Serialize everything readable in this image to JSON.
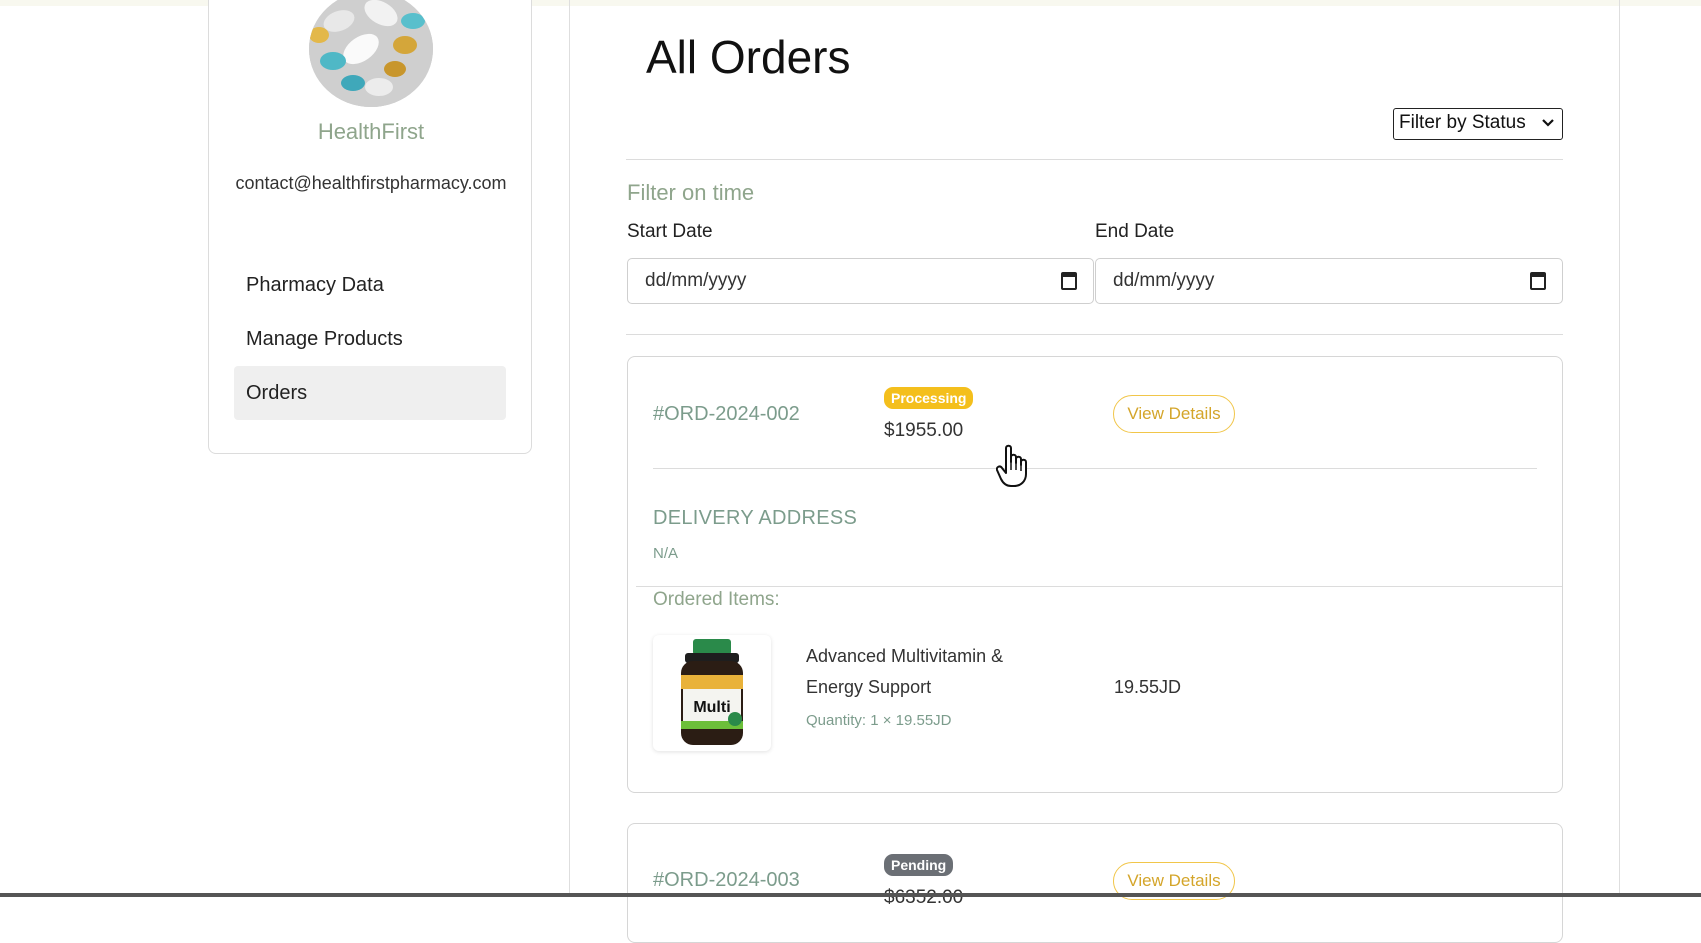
{
  "sidebar": {
    "pharmacy_name": "HealthFirst",
    "email": "contact@healthfirstpharmacy.com",
    "avatar_icon": "pills-photo",
    "nav": [
      {
        "label": "Pharmacy Data",
        "active": false
      },
      {
        "label": "Manage Products",
        "active": false
      },
      {
        "label": "Orders",
        "active": true
      }
    ]
  },
  "main": {
    "title": "All Orders",
    "status_filter": {
      "selected": "Filter by Status"
    },
    "time_filter": {
      "title": "Filter on time",
      "start_label": "Start Date",
      "end_label": "End Date",
      "start_placeholder": "dd/mm/yyyy",
      "end_placeholder": "dd/mm/yyyy"
    }
  },
  "orders": [
    {
      "id": "#ORD-2024-002",
      "status": "Processing",
      "status_color": "#f4bf1c",
      "total": "$1955.00",
      "view_label": "View Details",
      "address_title": "DELIVERY ADDRESS",
      "address": "N/A",
      "items_title": "Ordered Items:",
      "items": [
        {
          "name": "Advanced Multivitamin & Energy Support",
          "quantity": "Quantity: 1 × 19.55JD",
          "price": "19.55JD",
          "image_icon": "multivitamin-bottle"
        }
      ]
    },
    {
      "id": "#ORD-2024-003",
      "status": "Pending",
      "status_color": "#6b6f75",
      "total": "$6352.00",
      "view_label": "View Details"
    }
  ]
}
